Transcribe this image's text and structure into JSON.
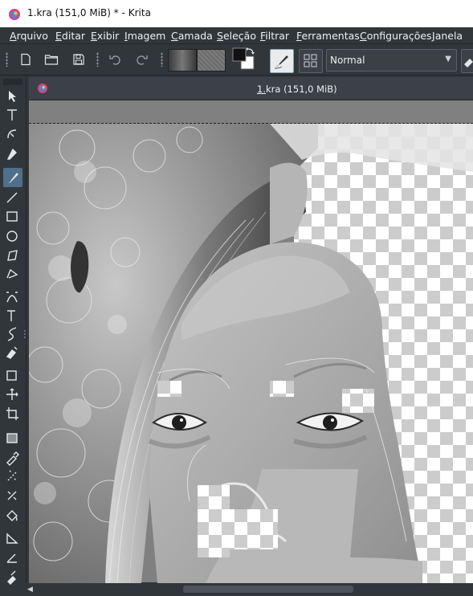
{
  "window": {
    "title": "1.kra (151,0 MiB) * - Krita"
  },
  "menubar": {
    "items": [
      "Arquivo",
      "Editar",
      "Exibir",
      "Imagem",
      "Camada",
      "Seleção",
      "Filtrar",
      "Ferramentas",
      "Configurações",
      "Janela"
    ]
  },
  "toolbar": {
    "blend_mode": "Normal",
    "buttons": [
      "new-document-icon",
      "open-folder-icon",
      "save-icon",
      "undo-icon",
      "redo-icon",
      "gradient-selector",
      "pattern-selector",
      "swap-colors-icon",
      "brush-editor-icon",
      "brush-presets-icon",
      "eraser-icon"
    ],
    "colors": {
      "foreground": "#111111",
      "background": "#ffffff"
    }
  },
  "document": {
    "tab_title": "1.kra (151,0 MiB)"
  },
  "toolbox": {
    "tools": [
      "select-shapes-icon",
      "text-icon",
      "edit-shapes-icon",
      "calligraphy-icon",
      "freehand-brush-icon",
      "line-icon",
      "rectangle-icon",
      "ellipse-icon",
      "polygon-icon",
      "polyline-icon",
      "bezier-curve-icon",
      "freehand-path-icon",
      "dynamic-brush-icon",
      "multibrush-icon",
      "transform-icon",
      "move-icon",
      "crop-icon",
      "gradient-icon",
      "color-sampler-icon",
      "smart-patch-icon",
      "fill-icon",
      "assistant-icon",
      "measure-icon",
      "reference-image-icon"
    ],
    "active_tool": "freehand-brush-icon"
  },
  "colors": {
    "ui_bg": "#31363b",
    "accent": "#3daee9",
    "canvas_surround": "#808080"
  }
}
